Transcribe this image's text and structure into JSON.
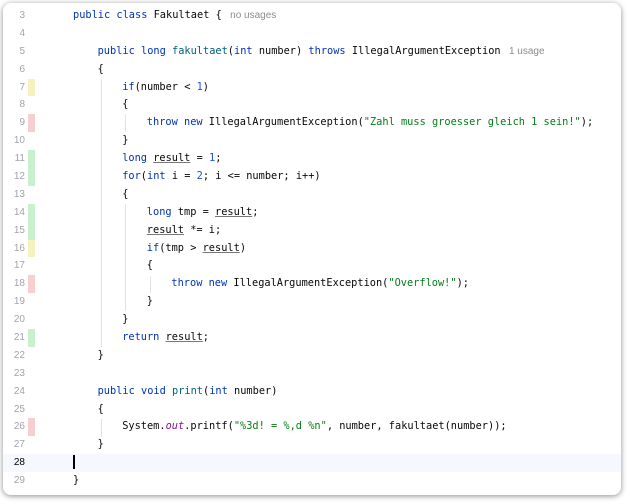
{
  "gutter_colors": {
    "added": "#c9f0cc",
    "modified": "#f6f1be",
    "deleted": "#f8cfcf"
  },
  "lines": [
    {
      "num": "3",
      "marker": "",
      "indent": 0,
      "tokens": [
        {
          "t": "kw",
          "v": "public class "
        },
        {
          "t": "",
          "v": "Fakultaet "
        },
        {
          "t": "",
          "v": "{"
        },
        {
          "t": "hint",
          "v": "   no usages"
        }
      ]
    },
    {
      "num": "4",
      "marker": "",
      "indent": 0,
      "tokens": []
    },
    {
      "num": "5",
      "marker": "",
      "indent": 1,
      "tokens": [
        {
          "t": "kw",
          "v": "public long "
        },
        {
          "t": "fn",
          "v": "fakultaet"
        },
        {
          "t": "",
          "v": "("
        },
        {
          "t": "kw",
          "v": "int "
        },
        {
          "t": "",
          "v": "number) "
        },
        {
          "t": "kw",
          "v": "throws "
        },
        {
          "t": "",
          "v": "IllegalArgumentException"
        },
        {
          "t": "hint",
          "v": "   1 usage"
        }
      ]
    },
    {
      "num": "6",
      "marker": "",
      "indent": 1,
      "tokens": [
        {
          "t": "",
          "v": "{"
        }
      ]
    },
    {
      "num": "7",
      "marker": "modified",
      "indent": 2,
      "tokens": [
        {
          "t": "kw",
          "v": "if"
        },
        {
          "t": "",
          "v": "(number < "
        },
        {
          "t": "num",
          "v": "1"
        },
        {
          "t": "",
          "v": ")"
        }
      ]
    },
    {
      "num": "8",
      "marker": "",
      "indent": 2,
      "tokens": [
        {
          "t": "",
          "v": "{"
        }
      ]
    },
    {
      "num": "9",
      "marker": "deleted",
      "indent": 3,
      "tokens": [
        {
          "t": "kw",
          "v": "throw new "
        },
        {
          "t": "",
          "v": "IllegalArgumentException("
        },
        {
          "t": "str",
          "v": "\"Zahl muss groesser gleich 1 sein!\""
        },
        {
          "t": "",
          "v": ");"
        }
      ]
    },
    {
      "num": "10",
      "marker": "",
      "indent": 2,
      "tokens": [
        {
          "t": "",
          "v": "}"
        }
      ]
    },
    {
      "num": "11",
      "marker": "added",
      "indent": 2,
      "tokens": [
        {
          "t": "kw",
          "v": "long "
        },
        {
          "t": "u",
          "v": "result"
        },
        {
          "t": "",
          "v": " = "
        },
        {
          "t": "num",
          "v": "1"
        },
        {
          "t": "",
          "v": ";"
        }
      ]
    },
    {
      "num": "12",
      "marker": "added",
      "indent": 2,
      "tokens": [
        {
          "t": "kw",
          "v": "for"
        },
        {
          "t": "",
          "v": "("
        },
        {
          "t": "kw",
          "v": "int "
        },
        {
          "t": "",
          "v": "i = "
        },
        {
          "t": "num",
          "v": "2"
        },
        {
          "t": "",
          "v": "; i <= number; i++)"
        }
      ]
    },
    {
      "num": "13",
      "marker": "",
      "indent": 2,
      "tokens": [
        {
          "t": "",
          "v": "{"
        }
      ]
    },
    {
      "num": "14",
      "marker": "added",
      "indent": 3,
      "tokens": [
        {
          "t": "kw",
          "v": "long "
        },
        {
          "t": "",
          "v": "tmp = "
        },
        {
          "t": "u",
          "v": "result"
        },
        {
          "t": "",
          "v": ";"
        }
      ]
    },
    {
      "num": "15",
      "marker": "added",
      "indent": 3,
      "tokens": [
        {
          "t": "u",
          "v": "result"
        },
        {
          "t": "",
          "v": " *= i;"
        }
      ]
    },
    {
      "num": "16",
      "marker": "modified",
      "indent": 3,
      "tokens": [
        {
          "t": "kw",
          "v": "if"
        },
        {
          "t": "",
          "v": "(tmp > "
        },
        {
          "t": "u",
          "v": "result"
        },
        {
          "t": "",
          "v": ")"
        }
      ]
    },
    {
      "num": "17",
      "marker": "",
      "indent": 3,
      "tokens": [
        {
          "t": "",
          "v": "{"
        }
      ]
    },
    {
      "num": "18",
      "marker": "deleted",
      "indent": 4,
      "tokens": [
        {
          "t": "kw",
          "v": "throw new "
        },
        {
          "t": "",
          "v": "IllegalArgumentException("
        },
        {
          "t": "str",
          "v": "\"Overflow!\""
        },
        {
          "t": "",
          "v": ");"
        }
      ]
    },
    {
      "num": "19",
      "marker": "",
      "indent": 3,
      "tokens": [
        {
          "t": "",
          "v": "}"
        }
      ]
    },
    {
      "num": "20",
      "marker": "",
      "indent": 2,
      "tokens": [
        {
          "t": "",
          "v": "}"
        }
      ]
    },
    {
      "num": "21",
      "marker": "added",
      "indent": 2,
      "tokens": [
        {
          "t": "kw",
          "v": "return "
        },
        {
          "t": "u",
          "v": "result"
        },
        {
          "t": "",
          "v": ";"
        }
      ]
    },
    {
      "num": "22",
      "marker": "",
      "indent": 1,
      "tokens": [
        {
          "t": "",
          "v": "}"
        }
      ]
    },
    {
      "num": "23",
      "marker": "",
      "indent": 0,
      "tokens": []
    },
    {
      "num": "24",
      "marker": "",
      "indent": 1,
      "tokens": [
        {
          "t": "kw",
          "v": "public void "
        },
        {
          "t": "fn",
          "v": "print"
        },
        {
          "t": "",
          "v": "("
        },
        {
          "t": "kw",
          "v": "int "
        },
        {
          "t": "",
          "v": "number)"
        }
      ]
    },
    {
      "num": "25",
      "marker": "",
      "indent": 1,
      "tokens": [
        {
          "t": "",
          "v": "{"
        }
      ]
    },
    {
      "num": "26",
      "marker": "deleted",
      "indent": 2,
      "tokens": [
        {
          "t": "",
          "v": "System."
        },
        {
          "t": "st",
          "v": "out"
        },
        {
          "t": "",
          "v": ".printf("
        },
        {
          "t": "str",
          "v": "\"%3d! = %,d %n\""
        },
        {
          "t": "",
          "v": ", number, fakultaet(number));"
        }
      ]
    },
    {
      "num": "27",
      "marker": "",
      "indent": 1,
      "tokens": [
        {
          "t": "",
          "v": "}"
        }
      ]
    },
    {
      "num": "28",
      "marker": "",
      "indent": 0,
      "current": true,
      "tokens": []
    },
    {
      "num": "29",
      "marker": "",
      "indent": 0,
      "tokens": [
        {
          "t": "",
          "v": "}"
        }
      ]
    }
  ]
}
